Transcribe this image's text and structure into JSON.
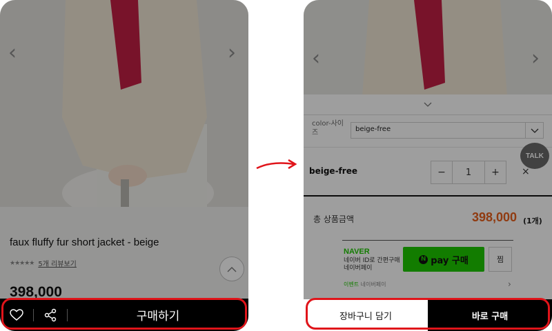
{
  "left_screen": {
    "product_title": "faux fluffy fur short jacket - beige",
    "rating_stars": "★★★★★",
    "review_link": "5개 리뷰보기",
    "price": "398,000",
    "buy_label": "구매하기",
    "icons": [
      "heart-icon",
      "share-icon",
      "chevron-left-icon",
      "chevron-right-icon",
      "chevron-up-icon"
    ]
  },
  "right_screen": {
    "option_label": "color-사이즈",
    "option_selected": "beige-free",
    "selected_item": "beige-free",
    "quantity": "1",
    "qty_minus": "−",
    "qty_plus": "+",
    "remove": "×",
    "total_label": "총 상품금액",
    "total_price": "398,000",
    "total_count": "(1개)",
    "naver": {
      "brand": "NAVER",
      "subtext": "네이버 ID로 간편구매 네이버페이",
      "pay_label": "pay 구매",
      "zzim": "찜",
      "event_label": "이벤트",
      "event_text": "네이버페이"
    },
    "talk_label": "TALK",
    "cart_label": "장바구니 담기",
    "buy_now_label": "바로 구매"
  },
  "colors": {
    "highlight": "#e0141a",
    "price_orange": "#e8601c",
    "naver_green": "#1ec800"
  }
}
